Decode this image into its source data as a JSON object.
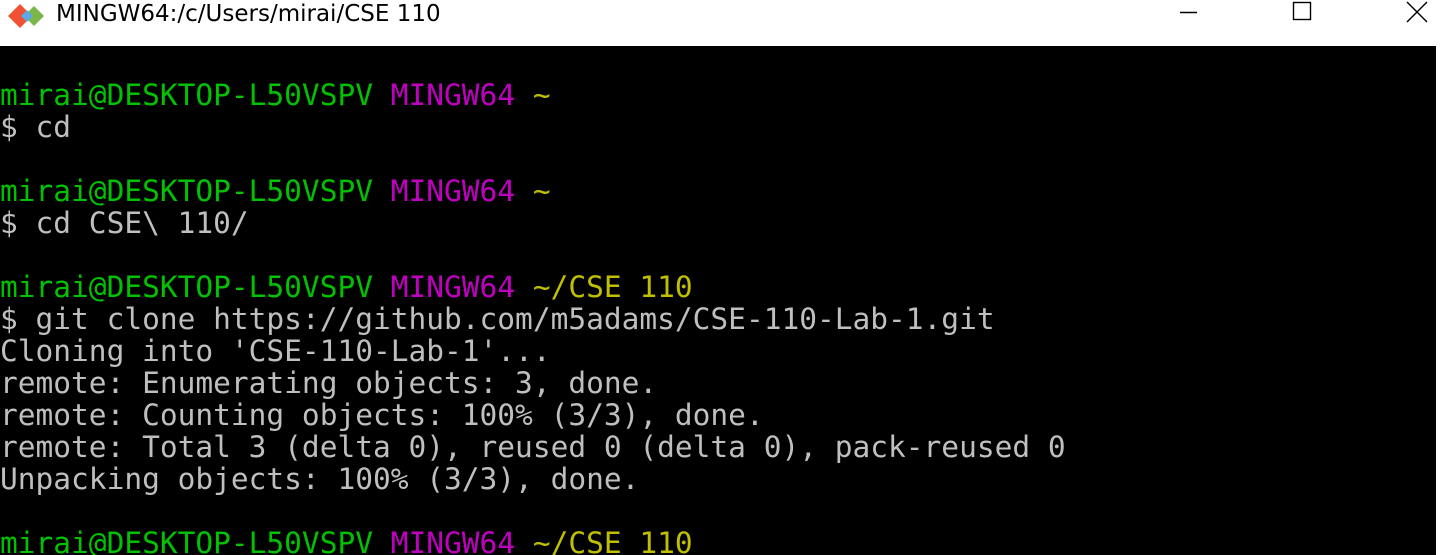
{
  "window": {
    "title": "MINGW64:/c/Users/mirai/CSE 110",
    "icon": "git-bash-icon",
    "buttons": {
      "minimize": "minimize-icon",
      "maximize": "maximize-icon",
      "close": "close-icon"
    }
  },
  "colors": {
    "user_host": "#00c200",
    "shell": "#c000c0",
    "path": "#c0c000",
    "text": "#bfbfbf",
    "background": "#000000"
  },
  "terminal": {
    "blocks": [
      {
        "user_host": "mirai@DESKTOP-L50VSPV",
        "shell": "MINGW64",
        "path": "~",
        "command": "$ cd",
        "output": []
      },
      {
        "user_host": "mirai@DESKTOP-L50VSPV",
        "shell": "MINGW64",
        "path": "~",
        "command": "$ cd CSE\\ 110/",
        "output": []
      },
      {
        "user_host": "mirai@DESKTOP-L50VSPV",
        "shell": "MINGW64",
        "path": "~/CSE 110",
        "command": "$ git clone https://github.com/m5adams/CSE-110-Lab-1.git",
        "output": [
          "Cloning into 'CSE-110-Lab-1'...",
          "remote: Enumerating objects: 3, done.",
          "remote: Counting objects: 100% (3/3), done.",
          "remote: Total 3 (delta 0), reused 0 (delta 0), pack-reused 0",
          "Unpacking objects: 100% (3/3), done."
        ]
      },
      {
        "user_host": "mirai@DESKTOP-L50VSPV",
        "shell": "MINGW64",
        "path": "~/CSE 110",
        "command": "",
        "output": []
      }
    ]
  }
}
